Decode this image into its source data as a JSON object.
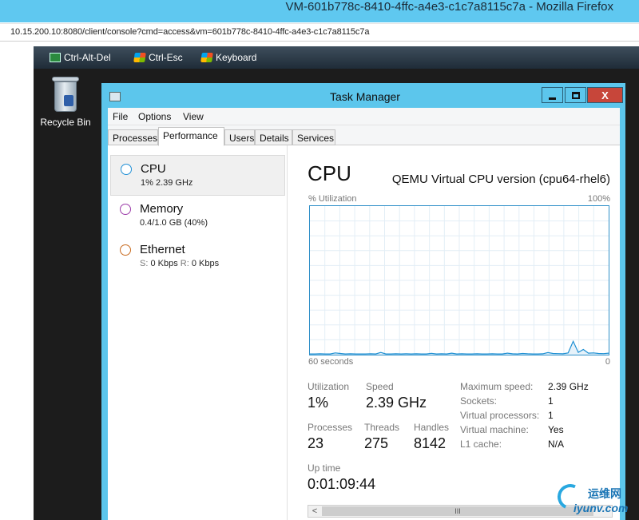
{
  "browser": {
    "window_title": "VM-601b778c-8410-4ffc-a4e3-c1c7a8115c7a - Mozilla Firefox",
    "url": "10.15.200.10:8080/client/console?cmd=access&vm=601b778c-8410-4ffc-a4e3-c1c7a8115c7a"
  },
  "console_toolbar": {
    "ctrl_alt_del": "Ctrl-Alt-Del",
    "ctrl_esc": "Ctrl-Esc",
    "keyboard": "Keyboard"
  },
  "desktop": {
    "recycle_bin_label": "Recycle Bin"
  },
  "task_manager": {
    "title": "Task Manager",
    "close_glyph": "X",
    "menu": [
      "File",
      "Options",
      "View"
    ],
    "tabs": [
      "Processes",
      "Performance",
      "Users",
      "Details",
      "Services"
    ],
    "active_tab": "Performance",
    "resources": [
      {
        "name": "CPU",
        "detail": "1% 2.39 GHz",
        "color": "#1f8fd6",
        "selected": true
      },
      {
        "name": "Memory",
        "detail": "0.4/1.0 GB (40%)",
        "color": "#9b3aa8",
        "selected": false
      },
      {
        "name": "Ethernet",
        "detail_prefix_s": "S:",
        "detail_value_s": "0 Kbps",
        "detail_prefix_r": "R:",
        "detail_value_r": "0 Kbps",
        "color": "#c86a1e",
        "selected": false
      }
    ],
    "cpu": {
      "title": "CPU",
      "model": "QEMU Virtual CPU version (cpu64-rhel6)",
      "utilization_label": "% Utilization",
      "max_label": "100%",
      "time_label": "60 seconds",
      "zero_label": "0",
      "utilization_history_pct": [
        0.5,
        0.5,
        0.6,
        0.5,
        0.5,
        1.2,
        0.8,
        0.5,
        0.6,
        0.5,
        0.5,
        0.5,
        0.6,
        0.5,
        1.5,
        0.5,
        0.5,
        0.6,
        0.5,
        0.6,
        0.5,
        0.6,
        0.5,
        0.5,
        0.9,
        0.5,
        0.6,
        0.5,
        1.0,
        0.5,
        0.6,
        0.5,
        0.5,
        0.6,
        0.5,
        0.5,
        0.6,
        0.5,
        0.5,
        1.0,
        0.6,
        0.5,
        0.8,
        0.6,
        0.5,
        0.5,
        0.6,
        1.4,
        0.8,
        0.7,
        0.6,
        1.2,
        9.0,
        1.5,
        3.5,
        1.0,
        1.2,
        0.8,
        0.7,
        1.0
      ],
      "stats": {
        "utilization_label": "Utilization",
        "utilization_value": "1%",
        "speed_label": "Speed",
        "speed_value": "2.39 GHz",
        "processes_label": "Processes",
        "processes_value": "23",
        "threads_label": "Threads",
        "threads_value": "275",
        "handles_label": "Handles",
        "handles_value": "8142",
        "uptime_label": "Up time",
        "uptime_value": "0:01:09:44"
      },
      "details": [
        {
          "label": "Maximum speed:",
          "value": "2.39 GHz"
        },
        {
          "label": "Sockets:",
          "value": "1"
        },
        {
          "label": "Virtual processors:",
          "value": "1"
        },
        {
          "label": "Virtual machine:",
          "value": "Yes"
        },
        {
          "label": "L1 cache:",
          "value": "N/A"
        }
      ]
    },
    "scroll_left_glyph": "<",
    "scroll_thumb_glyph": "III"
  },
  "watermark": {
    "cn": "运维网",
    "en": "iyunv.com"
  }
}
